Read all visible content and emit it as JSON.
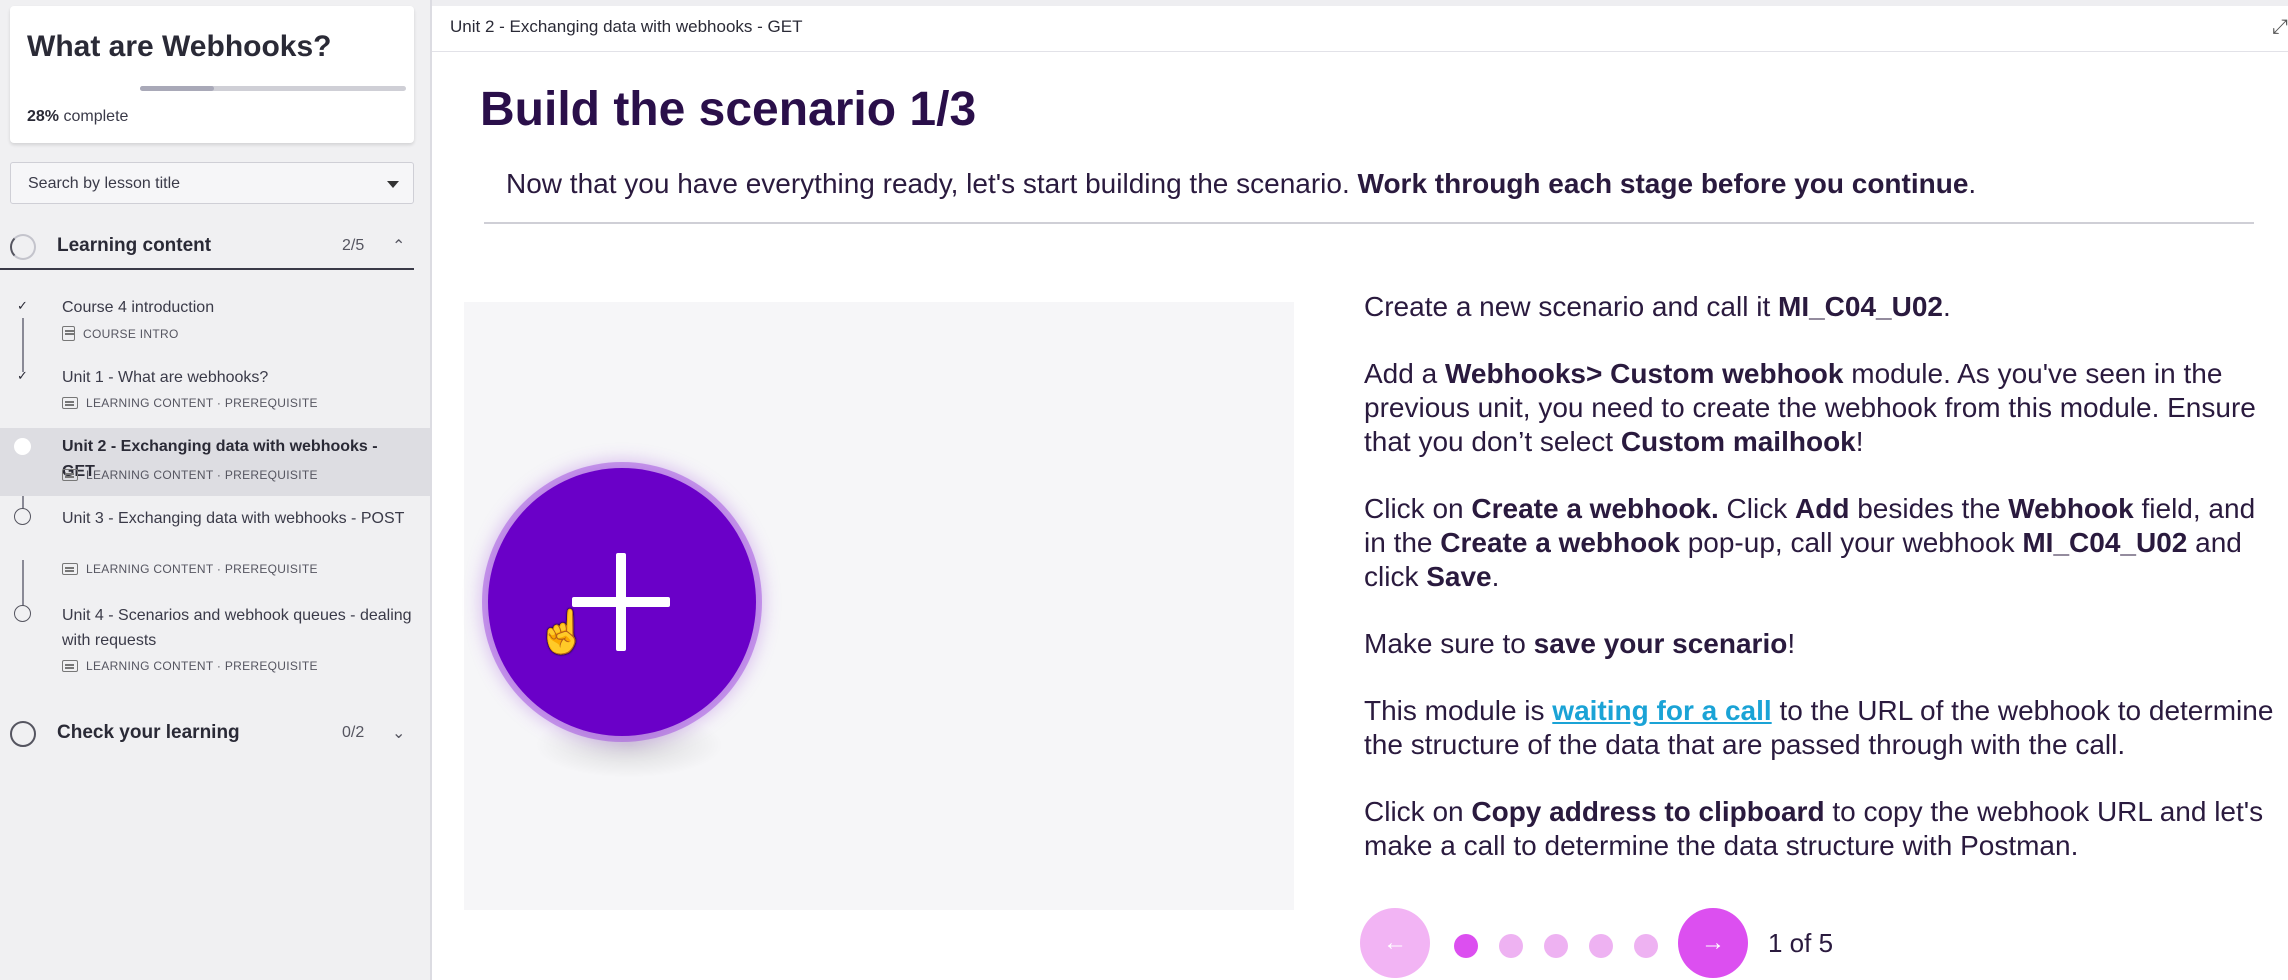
{
  "sidebar": {
    "course_title": "What are Webhooks?",
    "progress_percent": 28,
    "progress_pct_label": "28%",
    "progress_suffix": "complete",
    "search_placeholder": "Search by lesson title",
    "sections": [
      {
        "label": "Learning content",
        "count": "2/5",
        "expanded": true
      },
      {
        "label": "Check your learning",
        "count": "0/2",
        "expanded": false
      }
    ],
    "lessons": [
      {
        "title": "Course 4 introduction",
        "meta": "COURSE INTRO",
        "status": "done"
      },
      {
        "title": "Unit 1 - What are webhooks?",
        "meta": "LEARNING CONTENT · PREREQUISITE",
        "status": "done"
      },
      {
        "title": "Unit 2 - Exchanging data with webhooks - GET",
        "meta": "LEARNING CONTENT · PREREQUISITE",
        "status": "current"
      },
      {
        "title": "Unit 3 - Exchanging data with webhooks - POST",
        "meta": "LEARNING CONTENT · PREREQUISITE",
        "status": "open"
      },
      {
        "title": "Unit 4 - Scenarios and webhook queues - dealing with requests",
        "meta": "LEARNING CONTENT · PREREQUISITE",
        "status": "open"
      }
    ]
  },
  "main": {
    "breadcrumb": "Unit 2 - Exchanging data with webhooks - GET",
    "heading": "Build the scenario 1/3",
    "intro_plain": "Now that you have everything ready, let's start building the scenario. ",
    "intro_bold": "Work through each stage before you continue",
    "intro_end": ".",
    "p1": {
      "a": "Create a new scenario and call it ",
      "b": "MI_C04_U02",
      "c": "."
    },
    "p2": {
      "a": "Add a ",
      "b": "Webhooks> Custom webhook",
      "c": " module. As you've seen in the previous unit, you need to create the webhook from this module. Ensure that you don’t select ",
      "d": "Custom mailhook",
      "e": "!"
    },
    "p3": {
      "a": "Click on ",
      "b": "Create a webhook.",
      "c": " Click ",
      "d": "Add",
      "e": " besides the ",
      "f": "Webhook",
      "g": " field, and in the ",
      "h": "Create a webhook",
      "i": " pop-up, call your webhook ",
      "j": "MI_C04_U02",
      "k": " and click ",
      "l": "Save",
      "m": "."
    },
    "p4": {
      "a": "Make sure to ",
      "b": "save your scenario",
      "c": "!"
    },
    "p5": {
      "a": "This module is ",
      "link": "waiting for a call",
      "c": " to the URL of the webhook to determine the structure of the data that are passed through with the call."
    },
    "p6": {
      "a": "Click on ",
      "b": "Copy address to clipboard",
      "c": " to copy the webhook URL and let's make a call to determine the data structure with Postman."
    },
    "pager": {
      "current": 1,
      "total": 5,
      "label": "1 of 5"
    }
  },
  "icons": {
    "prev": "arrow-left-icon",
    "next": "arrow-right-icon",
    "expand": "expand-icon",
    "check": "check-icon"
  },
  "colors": {
    "heading": "#2a0f4a",
    "accent_purple": "#6a00c8",
    "pager_active": "#dc4ff0",
    "pager_inactive": "#eeb2f2",
    "link": "#1aa3d6"
  }
}
